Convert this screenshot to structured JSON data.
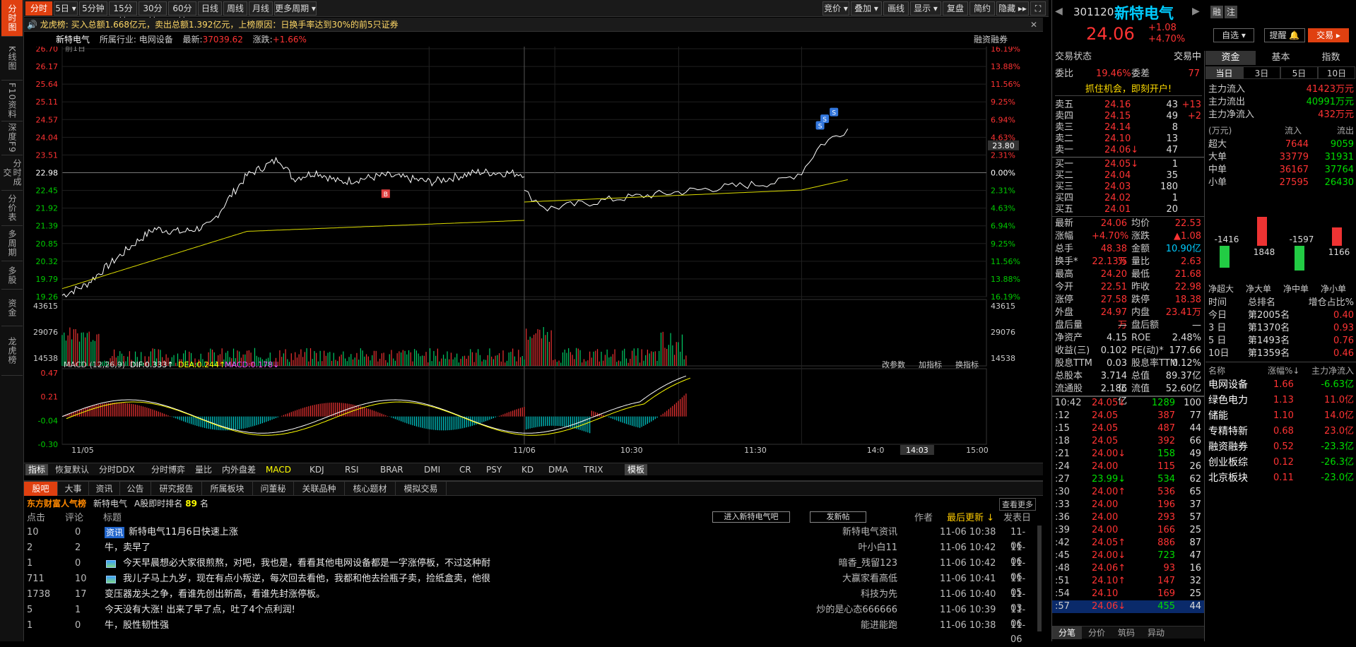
{
  "left_nav": [
    "分时图",
    "K线图",
    "F10资料",
    "深度F9",
    "分时成交",
    "分价表",
    "多周期",
    "多股",
    "资金",
    "龙虎榜"
  ],
  "toolbar": {
    "left": [
      "分时",
      "5日 ▾",
      "5分钟",
      "15分钟",
      "30分钟",
      "60分钟",
      "日线",
      "周线",
      "月线",
      "更多周期 ▾"
    ],
    "right": [
      "竞价 ▾",
      "叠加 ▾",
      "画线",
      "显示 ▾",
      "复盘",
      "简约",
      "隐藏 ▸▸",
      "⛶"
    ]
  },
  "lhb": {
    "label": "龙虎榜:",
    "text": "买入总额1.668亿元，卖出总额1.392亿元，上榜原因：日换手率达到30%的前5只证券"
  },
  "info": {
    "name": "新特电气",
    "industry": "所属行业: 电网设备",
    "latest_label": "最新:",
    "latest": "37039.62",
    "change_label": "涨跌:",
    "change": "+1.66%",
    "margin": "融资融券"
  },
  "chart": {
    "prev_label": "前1日",
    "y_left": [
      "26.70",
      "26.17",
      "25.64",
      "25.11",
      "24.57",
      "24.04",
      "23.51",
      "22.98",
      "22.45",
      "21.92",
      "21.39",
      "20.85",
      "20.32",
      "19.79",
      "19.26"
    ],
    "y_right": [
      "16.19%",
      "13.88%",
      "11.56%",
      "9.25%",
      "6.94%",
      "4.63%",
      "2.31%",
      "0.00%",
      "2.31%",
      "4.63%",
      "6.94%",
      "9.25%",
      "11.56%",
      "13.88%",
      "16.19%"
    ],
    "cursor_price": "23.80",
    "vol_left": [
      "43615",
      "29076",
      "14538"
    ],
    "vol_right": [
      "43615",
      "29076",
      "14538"
    ],
    "macd_title": "MACD (12,26,9)",
    "dif": "DIF:0.333↑",
    "dea": "DEA:0.244↑",
    "macd": "MACD:0.178↓",
    "macd_y": [
      "0.47",
      "0.21",
      "-0.04",
      "-0.30"
    ],
    "macd_btns": [
      "改参数",
      "加指标",
      "换指标"
    ],
    "x_labels": [
      "11/05",
      "11/06",
      "10:30",
      "11:30",
      "14:0",
      "14:03",
      "15:00"
    ]
  },
  "indicator_tabs": [
    "指标",
    "恢复默认",
    "分时DDX",
    "分时博弈",
    "量比",
    "内外盘差",
    "MACD",
    "KDJ",
    "RSI",
    "BRAR",
    "DMI",
    "CR",
    "PSY",
    "KD",
    "DMA",
    "TRIX",
    "模板"
  ],
  "bottom": {
    "tabs": [
      "股吧",
      "大事",
      "资讯",
      "公告",
      "研究报告",
      "所属板块",
      "问董秘",
      "关联品种",
      "核心题材",
      "模拟交易"
    ],
    "rank_title": "东方财富人气榜",
    "rank_name": "新特电气",
    "rank_label": "A股即时排名",
    "rank_num": "89",
    "rank_unit": "名",
    "more": "查看更多",
    "headers": [
      "点击",
      "评论",
      "标题",
      "作者",
      "最后更新 ↓",
      "发表日"
    ],
    "btn_enter": "进入新特电气吧",
    "btn_post": "发新帖",
    "posts": [
      {
        "clicks": "10",
        "comments": "0",
        "tag": "资讯",
        "title": "新特电气11月6日快速上涨",
        "author": "新特电气资讯",
        "updated": "11-06 10:38",
        "date": "11-06"
      },
      {
        "clicks": "2",
        "comments": "2",
        "tag": "",
        "title": "牛，卖早了",
        "author": "叶小白11",
        "updated": "11-06 10:42",
        "date": "11-06"
      },
      {
        "clicks": "1",
        "comments": "0",
        "tag": "img",
        "title": "今天早晨想必大家很煎熬，对吧，我也是，看看其他电网设备都是一字涨停板，不过这种耐",
        "author": "暗香_残留123",
        "updated": "11-06 10:42",
        "date": "11-06"
      },
      {
        "clicks": "711",
        "comments": "10",
        "tag": "img",
        "title": "我儿子马上九岁，现在有点小叛逆，每次回去看他，我都和他去捡瓶子卖，捡纸盒卖，他很",
        "author": "大赢家看高低",
        "updated": "11-06 10:41",
        "date": "11-05"
      },
      {
        "clicks": "1738",
        "comments": "17",
        "tag": "",
        "title": "变压器龙头之争，看谁先创出新高，看谁先封涨停板。",
        "author": "科技为先",
        "updated": "11-06 10:40",
        "date": "11-03"
      },
      {
        "clicks": "5",
        "comments": "1",
        "tag": "",
        "title": "今天没有大涨! 出来了早了点，吐了4个点利润!",
        "author": "炒的是心态666666",
        "updated": "11-06 10:39",
        "date": "11-06"
      },
      {
        "clicks": "1",
        "comments": "0",
        "tag": "",
        "title": "牛，股性韧性强",
        "author": "能进能跑",
        "updated": "11-06 10:38",
        "date": "11-06"
      }
    ]
  },
  "quote": {
    "code": "301120",
    "name": "新特电气",
    "price": "24.06",
    "change": "+1.08",
    "pct": "+4.70%",
    "btns": [
      "自选 ▾",
      "提醒 🔔",
      "交易 ▸"
    ],
    "status_label": "交易状态",
    "status": "交易中",
    "weibi_label": "委比",
    "weibi": "19.46%",
    "weicha_label": "委差",
    "weicha": "77",
    "promo": "抓住机会，即刻开户!",
    "asks": [
      {
        "label": "卖五",
        "price": "24.16",
        "vol": "43",
        "chg": "+13"
      },
      {
        "label": "卖四",
        "price": "24.15",
        "vol": "49",
        "chg": "+2"
      },
      {
        "label": "卖三",
        "price": "24.14",
        "vol": "8",
        "chg": ""
      },
      {
        "label": "卖二",
        "price": "24.10",
        "vol": "13",
        "chg": ""
      },
      {
        "label": "卖一",
        "price": "24.06↓",
        "vol": "47",
        "chg": ""
      }
    ],
    "bids": [
      {
        "label": "买一",
        "price": "24.05↓",
        "vol": "1",
        "chg": ""
      },
      {
        "label": "买二",
        "price": "24.04",
        "vol": "35",
        "chg": ""
      },
      {
        "label": "买三",
        "price": "24.03",
        "vol": "180",
        "chg": ""
      },
      {
        "label": "买四",
        "price": "24.02",
        "vol": "1",
        "chg": ""
      },
      {
        "label": "买五",
        "price": "24.01",
        "vol": "20",
        "chg": ""
      }
    ],
    "stats": [
      [
        "最新",
        "24.06",
        "均价",
        "22.53"
      ],
      [
        "涨幅",
        "+4.70%",
        "涨跌",
        "▲1.08"
      ],
      [
        "总手",
        "48.38万",
        "金额",
        "10.90亿"
      ],
      [
        "换手*",
        "22.13%",
        "量比",
        "2.63"
      ],
      [
        "最高",
        "24.20",
        "最低",
        "21.68"
      ],
      [
        "今开",
        "22.51",
        "昨收",
        "22.98"
      ],
      [
        "涨停",
        "27.58",
        "跌停",
        "18.38"
      ],
      [
        "外盘",
        "24.97万",
        "内盘",
        "23.41万"
      ],
      [
        "盘后量",
        "—",
        "盘后额",
        "—"
      ],
      [
        "净资产",
        "4.15",
        "ROE",
        "2.48%"
      ],
      [
        "收益(三)",
        "0.102",
        "PE(动)*",
        "177.66"
      ],
      [
        "股息TTM",
        "0.03",
        "股息率TTM",
        "0.12%"
      ],
      [
        "总股本",
        "3.714亿",
        "总值",
        "89.37亿"
      ],
      [
        "流通股",
        "2.186亿",
        "流值",
        "52.60亿"
      ]
    ],
    "ticks": [
      {
        "t": "10:42",
        "p": "24.05↓",
        "v": "1289",
        "n": "100"
      },
      {
        "t": ":12",
        "p": "24.05",
        "v": "387",
        "n": "77"
      },
      {
        "t": ":15",
        "p": "24.05",
        "v": "487",
        "n": "44"
      },
      {
        "t": ":18",
        "p": "24.05",
        "v": "392",
        "n": "66"
      },
      {
        "t": ":21",
        "p": "24.00↓",
        "v": "158",
        "n": "49"
      },
      {
        "t": ":24",
        "p": "24.00",
        "v": "115",
        "n": "26"
      },
      {
        "t": ":27",
        "p": "23.99↓",
        "v": "534",
        "n": "62"
      },
      {
        "t": ":30",
        "p": "24.00↑",
        "v": "536",
        "n": "65"
      },
      {
        "t": ":33",
        "p": "24.00",
        "v": "196",
        "n": "37"
      },
      {
        "t": ":36",
        "p": "24.00",
        "v": "293",
        "n": "57"
      },
      {
        "t": ":39",
        "p": "24.00",
        "v": "166",
        "n": "25"
      },
      {
        "t": ":42",
        "p": "24.05↑",
        "v": "886",
        "n": "87"
      },
      {
        "t": ":45",
        "p": "24.00↓",
        "v": "723",
        "n": "47"
      },
      {
        "t": ":48",
        "p": "24.06↑",
        "v": "93",
        "n": "16"
      },
      {
        "t": ":51",
        "p": "24.10↑",
        "v": "147",
        "n": "32"
      },
      {
        "t": ":54",
        "p": "24.10",
        "v": "169",
        "n": "25"
      },
      {
        "t": ":57",
        "p": "24.06↓",
        "v": "455",
        "n": "44"
      }
    ],
    "tick_tabs": [
      "分笔",
      "分价",
      "筑码",
      "异动"
    ]
  },
  "funds": {
    "tabs": [
      "资金",
      "基本",
      "指数"
    ],
    "periods": [
      "当日",
      "3日",
      "5日",
      "10日"
    ],
    "main_in_label": "主力流入",
    "main_in": "41423万元",
    "main_out_label": "主力流出",
    "main_out": "40991万元",
    "main_net_label": "主力净流入",
    "main_net": "432万元",
    "unit": "(万元)",
    "in_label": "流入",
    "out_label": "流出",
    "rows": [
      [
        "超大",
        "7644",
        "9059"
      ],
      [
        "大单",
        "33779",
        "31931"
      ],
      [
        "中单",
        "36167",
        "37764"
      ],
      [
        "小单",
        "27595",
        "26430"
      ]
    ],
    "bar_values": [
      -1416,
      1848,
      -1597,
      1166
    ],
    "bar_labels": [
      "-1416",
      "1848",
      "-1597",
      "1166"
    ],
    "bar_cats": [
      "净超大",
      "净大单",
      "净中单",
      "净小单"
    ],
    "rank_headers": [
      "时间",
      "总排名",
      "增仓占比%"
    ],
    "ranks": [
      [
        "今日",
        "第2005名",
        "0.40"
      ],
      [
        "3 日",
        "第1370名",
        "0.93"
      ],
      [
        "5 日",
        "第1493名",
        "0.76"
      ],
      [
        "10日",
        "第1359名",
        "0.46"
      ]
    ],
    "sector_headers": [
      "名称",
      "涨幅%↓",
      "主力净流入"
    ],
    "sectors": [
      [
        "电网设备",
        "1.66",
        "-6.63亿"
      ],
      [
        "绿色电力",
        "1.13",
        "11.0亿"
      ],
      [
        "储能",
        "1.10",
        "14.0亿"
      ],
      [
        "专精特新",
        "0.68",
        "23.0亿"
      ],
      [
        "融资融券",
        "0.52",
        "-23.3亿"
      ],
      [
        "创业板综",
        "0.12",
        "-26.3亿"
      ],
      [
        "北京板块",
        "0.11",
        "-23.0亿"
      ]
    ]
  }
}
